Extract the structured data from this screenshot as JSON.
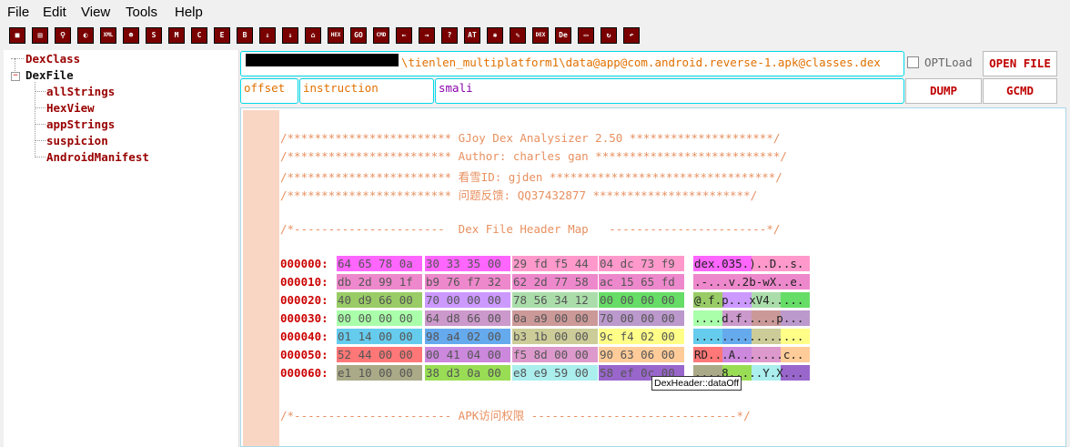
{
  "menu": {
    "items": [
      "File",
      "Edit",
      "View",
      "Tools",
      "Help"
    ]
  },
  "toolbar": {
    "icons": [
      "stop-icon",
      "save-icon",
      "search-icon",
      "toggle-icon",
      "xml-icon",
      "android-icon",
      "s-icon",
      "m-icon",
      "c-icon",
      "e-icon",
      "b-icon",
      "sort-desc-icon",
      "download-icon",
      "home-icon",
      "hex-icon",
      "go-icon",
      "cmd-icon",
      "arrow-left-icon",
      "arrow-right-icon",
      "help-icon",
      "at-icon",
      "bug-icon",
      "edit-search-icon",
      "dex-icon",
      "de-icon",
      "page-icon",
      "refresh-icon",
      "undo-icon"
    ],
    "labels": {
      "xml-icon": "XML",
      "s-icon": "S",
      "m-icon": "M",
      "c-icon": "C",
      "e-icon": "E",
      "b-icon": "B",
      "hex-icon": "HEX",
      "go-icon": "GO",
      "cmd-icon": "CMD",
      "help-icon": "?",
      "at-icon": "AT",
      "dex-icon": "DEX",
      "de-icon": "De"
    }
  },
  "tree": {
    "dexclass": "DexClass",
    "dexfile": "DexFile",
    "children": [
      "allStrings",
      "HexView",
      "appStrings",
      "suspicion",
      "AndroidManifest"
    ]
  },
  "top": {
    "path": "\\tienlen_multiplatform1\\data@app@com.android.reverse-1.apk@classes.dex",
    "opt_label": "OPTLoad",
    "open_file": "OPEN FILE",
    "offset": "offset",
    "instruction": "instruction",
    "smali": "smali",
    "dump": "DUMP",
    "gcmd": "GCMD"
  },
  "editor": {
    "banner": [
      "/************************ GJoy Dex Analysizer 2.50 *********************/",
      "/************************ Author: charles gan ***************************/",
      "/************************ 看雪ID: gjden *********************************/",
      "/************************ 问题反馈: QQ37432877 ***********************/",
      "",
      "/*----------------------  Dex File Header Map   -----------------------*/"
    ],
    "hex_rows": [
      {
        "offset": "000000:",
        "hex": [
          "64 65 78 0a",
          "30 33 35 00",
          "29 fd f5 44",
          "04 dc 73 f9"
        ],
        "ascii": "dex.035.)..D..s."
      },
      {
        "offset": "000010:",
        "hex": [
          "db 2d 99 1f",
          "b9 76 f7 32",
          "62 2d 77 58",
          "ac 15 65 fd"
        ],
        "ascii": ".-...v.2b-wX..e."
      },
      {
        "offset": "000020:",
        "hex": [
          "40 d9 66 00",
          "70 00 00 00",
          "78 56 34 12",
          "00 00 00 00"
        ],
        "ascii": "@.f.p...xV4....."
      },
      {
        "offset": "000030:",
        "hex": [
          "00 00 00 00",
          "64 d8 66 00",
          "0a a9 00 00",
          "70 00 00 00"
        ],
        "ascii": "....d.f.....p..."
      },
      {
        "offset": "000040:",
        "hex": [
          "01 14 00 00",
          "98 a4 02 00",
          "b3 1b 00 00",
          "9c f4 02 00"
        ],
        "ascii": "................"
      },
      {
        "offset": "000050:",
        "hex": [
          "52 44 00 00",
          "00 41 04 00",
          "f5 8d 00 00",
          "90 63 06 00"
        ],
        "ascii": "RD...A.......c.."
      },
      {
        "offset": "000060:",
        "hex": [
          "e1 10 00 00",
          "38 d3 0a 00",
          "e8 e9 59 00",
          "58 ef 0c 00"
        ],
        "ascii": "....8.....Y.X..."
      }
    ],
    "footer": "/*----------------------- APK访问权限 ------------------------------*/",
    "tooltip": "DexHeader::dataOff"
  },
  "colors": {
    "row_colors": [
      [
        "#ff66ff",
        "#ff66ff",
        "#ff99cc",
        "#ff99cc"
      ],
      [
        "#ee88cc",
        "#ee88cc",
        "#ee88cc",
        "#ee88cc"
      ],
      [
        "#99cc66",
        "#cc99ff",
        "#aaddaa",
        "#66dd66"
      ],
      [
        "#aaffaa",
        "#cc99cc",
        "#cc9999",
        "#bb99cc"
      ],
      [
        "#66ccee",
        "#66aaee",
        "#cccc99",
        "#ffff88"
      ],
      [
        "#ff7777",
        "#cc88dd",
        "#dd99cc",
        "#ffcc99"
      ],
      [
        "#aaaa88",
        "#99dd55",
        "#aaeeee",
        "#9966cc"
      ]
    ]
  }
}
